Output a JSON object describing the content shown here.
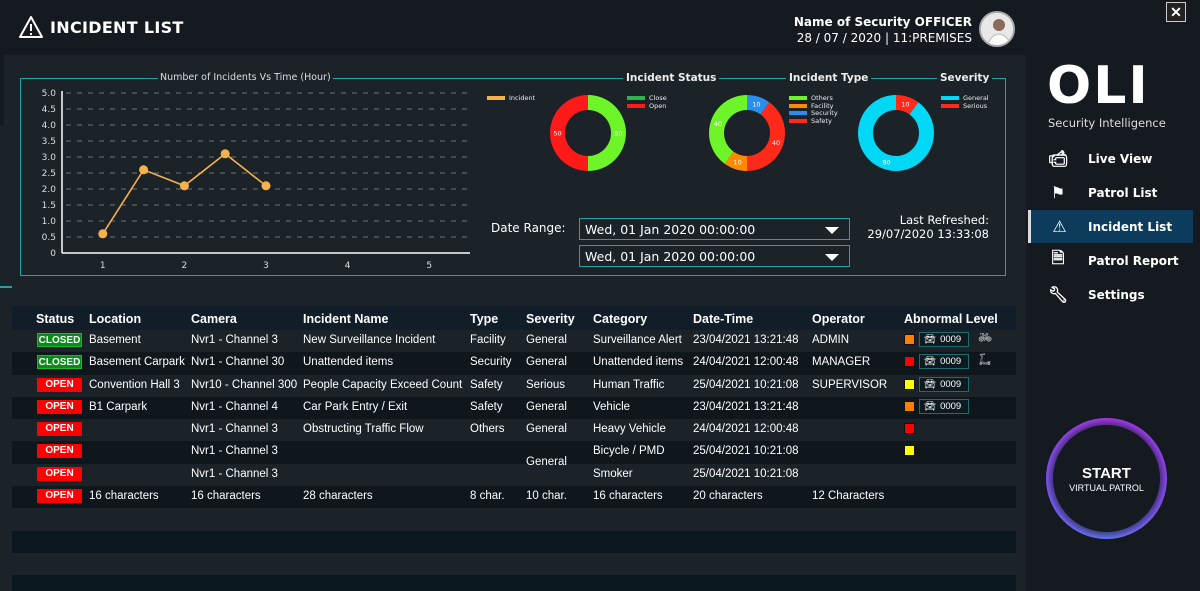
{
  "header": {
    "title": "INCIDENT LIST",
    "user_line1": "Name of Security OFFICER",
    "user_line2": "28 / 07 / 2020 | 11:PREMISES",
    "close_icon": "close-window-icon"
  },
  "dashboard": {
    "date_range_label": "Date Range:",
    "date_from": "Wed, 01 Jan 2020  00:00:00",
    "date_to": "Wed, 01 Jan 2020  00:00:00",
    "last_refreshed_label": "Last Refreshed:",
    "last_refreshed_value": "29/07/2020 13:33:08"
  },
  "chart_data": [
    {
      "type": "line",
      "title": "Number of Incidents Vs Time (Hour)",
      "xlabel": "",
      "ylabel": "",
      "x": [
        1,
        1.5,
        2,
        2.5,
        3
      ],
      "series": [
        {
          "name": "Incident",
          "values": [
            0.6,
            2.6,
            2.1,
            3.1,
            2.1
          ],
          "color": "#f5b14a"
        }
      ],
      "xticks": [
        "1",
        "2",
        "3",
        "4",
        "5"
      ],
      "yticks": [
        "0",
        "0.5",
        "1.0",
        "1.5",
        "2.0",
        "2.5",
        "3.0",
        "3.5",
        "4.0",
        "4.5",
        "5.0"
      ],
      "xlim": [
        0.5,
        5.5
      ],
      "ylim": [
        0,
        5
      ],
      "grid": true,
      "legend": "top-right"
    },
    {
      "type": "pie",
      "title": "Incident Status",
      "categories": [
        "Close",
        "Open"
      ],
      "values": [
        50,
        50
      ],
      "colors": [
        "#6ef52a",
        "#ff1a1a"
      ],
      "legend_colors": [
        "#2fb34a",
        "#ff1a1a"
      ]
    },
    {
      "type": "pie",
      "title": "Incident Type",
      "categories": [
        "Security",
        "Safety",
        "Facility",
        "Others"
      ],
      "values": [
        10,
        40,
        10,
        40
      ],
      "colors": [
        "#2a8ef0",
        "#ff2a1a",
        "#ff8a00",
        "#6ef52a"
      ],
      "legend": [
        "Others",
        "Facility",
        "Security",
        "Safety"
      ],
      "legend_colors": [
        "#6ef52a",
        "#ff8a00",
        "#2a8ef0",
        "#ff2a1a"
      ]
    },
    {
      "type": "pie",
      "title": "Severity",
      "categories": [
        "Serious",
        "General"
      ],
      "values": [
        10,
        90
      ],
      "colors": [
        "#ff2a1a",
        "#00d8f5"
      ],
      "legend": [
        "General",
        "Serious"
      ],
      "legend_colors": [
        "#00d8f5",
        "#ff2a1a"
      ]
    }
  ],
  "table": {
    "headers": [
      "Status",
      "Location",
      "Camera",
      "Incident Name",
      "Type",
      "Severity",
      "Category",
      "Date-Time",
      "Operator",
      "Abnormal Level"
    ],
    "rows": [
      {
        "status": "CLOSED",
        "location": "Basement",
        "camera": "Nvr1 - Channel 3",
        "name": "New Surveillance Incident",
        "type": "Facility",
        "severity": "General",
        "category": "Surveillance Alert",
        "datetime": "23/04/2021  13:21:48",
        "operator": "ADMIN",
        "level_color": "#ff8000",
        "count": "0009",
        "extra_icon": "bicycle"
      },
      {
        "status": "CLOSED",
        "location": "Basement Carpark",
        "camera": "Nvr1 - Channel 30",
        "name": "Unattended items",
        "type": "Security",
        "severity": "General",
        "category": "Unattended items",
        "datetime": "24/04/2021  12:00:48",
        "operator": "MANAGER",
        "level_color": "#ff0000",
        "count": "0009",
        "extra_icon": "scooter"
      },
      {
        "status": "OPEN",
        "location": "Convention Hall 3",
        "camera": "Nvr10 - Channel 300",
        "name": "People Capacity Exceed Count",
        "type": "Safety",
        "severity": "Serious",
        "category": "Human Traffic",
        "datetime": "25/04/2021  10:21:08",
        "operator": "SUPERVISOR",
        "level_color": "#ffff00",
        "count": "0009"
      },
      {
        "status": "OPEN",
        "location": "B1 Carpark",
        "camera": "Nvr1 - Channel 4",
        "name": "Car Park Entry / Exit",
        "type": "Safety",
        "severity": "General",
        "category": "Vehicle",
        "datetime": "23/04/2021  13:21:48",
        "operator": "",
        "level_color": "#ff8000",
        "count": "0009"
      },
      {
        "status": "OPEN",
        "location": "",
        "camera": "Nvr1 - Channel 3",
        "name": "Obstructing Traffic Flow",
        "type": "Others",
        "severity": "General",
        "category": "Heavy Vehicle",
        "datetime": "24/04/2021  12:00:48",
        "operator": "",
        "level_color": "#ff0000"
      },
      {
        "status": "OPEN",
        "location": "",
        "camera": "Nvr1 - Channel 3",
        "name": "",
        "type": "",
        "severity": "General",
        "category": "Bicycle / PMD",
        "datetime": "25/04/2021  10:21:08",
        "operator": "",
        "level_color": "#ffff00"
      },
      {
        "status": "OPEN",
        "location": "",
        "camera": "Nvr1 - Channel 3",
        "name": "",
        "type": "",
        "severity": "",
        "category": "Smoker",
        "datetime": "25/04/2021  10:21:08",
        "operator": ""
      },
      {
        "status": "OPEN",
        "location": "16 characters",
        "camera": "16 characters",
        "name": "28 characters",
        "type": "8 char.",
        "severity": "10 char.",
        "category": "16 characters",
        "datetime": "20 characters",
        "operator": "12 Characters"
      }
    ]
  },
  "sidebar": {
    "logo": "OLI",
    "tagline": "Security Intelligence",
    "items": [
      {
        "label": "Live View",
        "icon": "cctv-camera-icon"
      },
      {
        "label": "Patrol List",
        "icon": "route-pin-icon"
      },
      {
        "label": "Incident List",
        "icon": "warning-triangle-icon",
        "active": true
      },
      {
        "label": "Patrol Report",
        "icon": "document-list-icon"
      },
      {
        "label": "Settings",
        "icon": "wrench-icon"
      }
    ],
    "start_label": "START",
    "start_sublabel": "VIRTUAL PATROL"
  }
}
